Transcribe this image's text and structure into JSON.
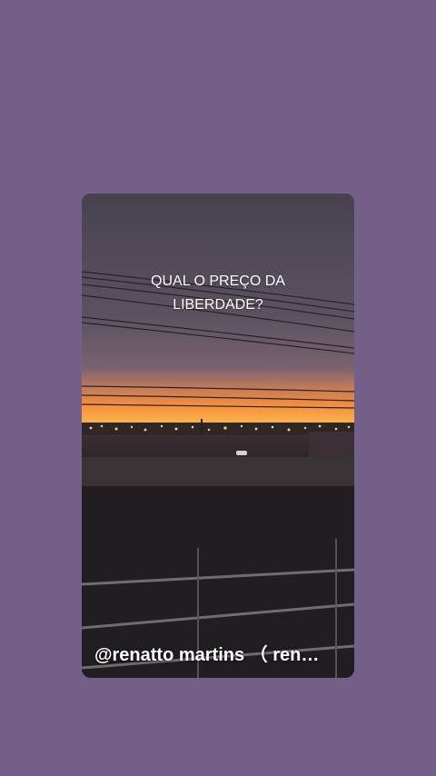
{
  "story": {
    "caption_line1": "QUAL O PREÇO DA",
    "caption_line2": "LIBERDADE?",
    "credit": "@renatto martins （ ren…"
  },
  "colors": {
    "background": "#735f88",
    "sky_top": "#4a4452",
    "horizon_orange": "#f08a2a",
    "caption_text": "#ffffff"
  }
}
